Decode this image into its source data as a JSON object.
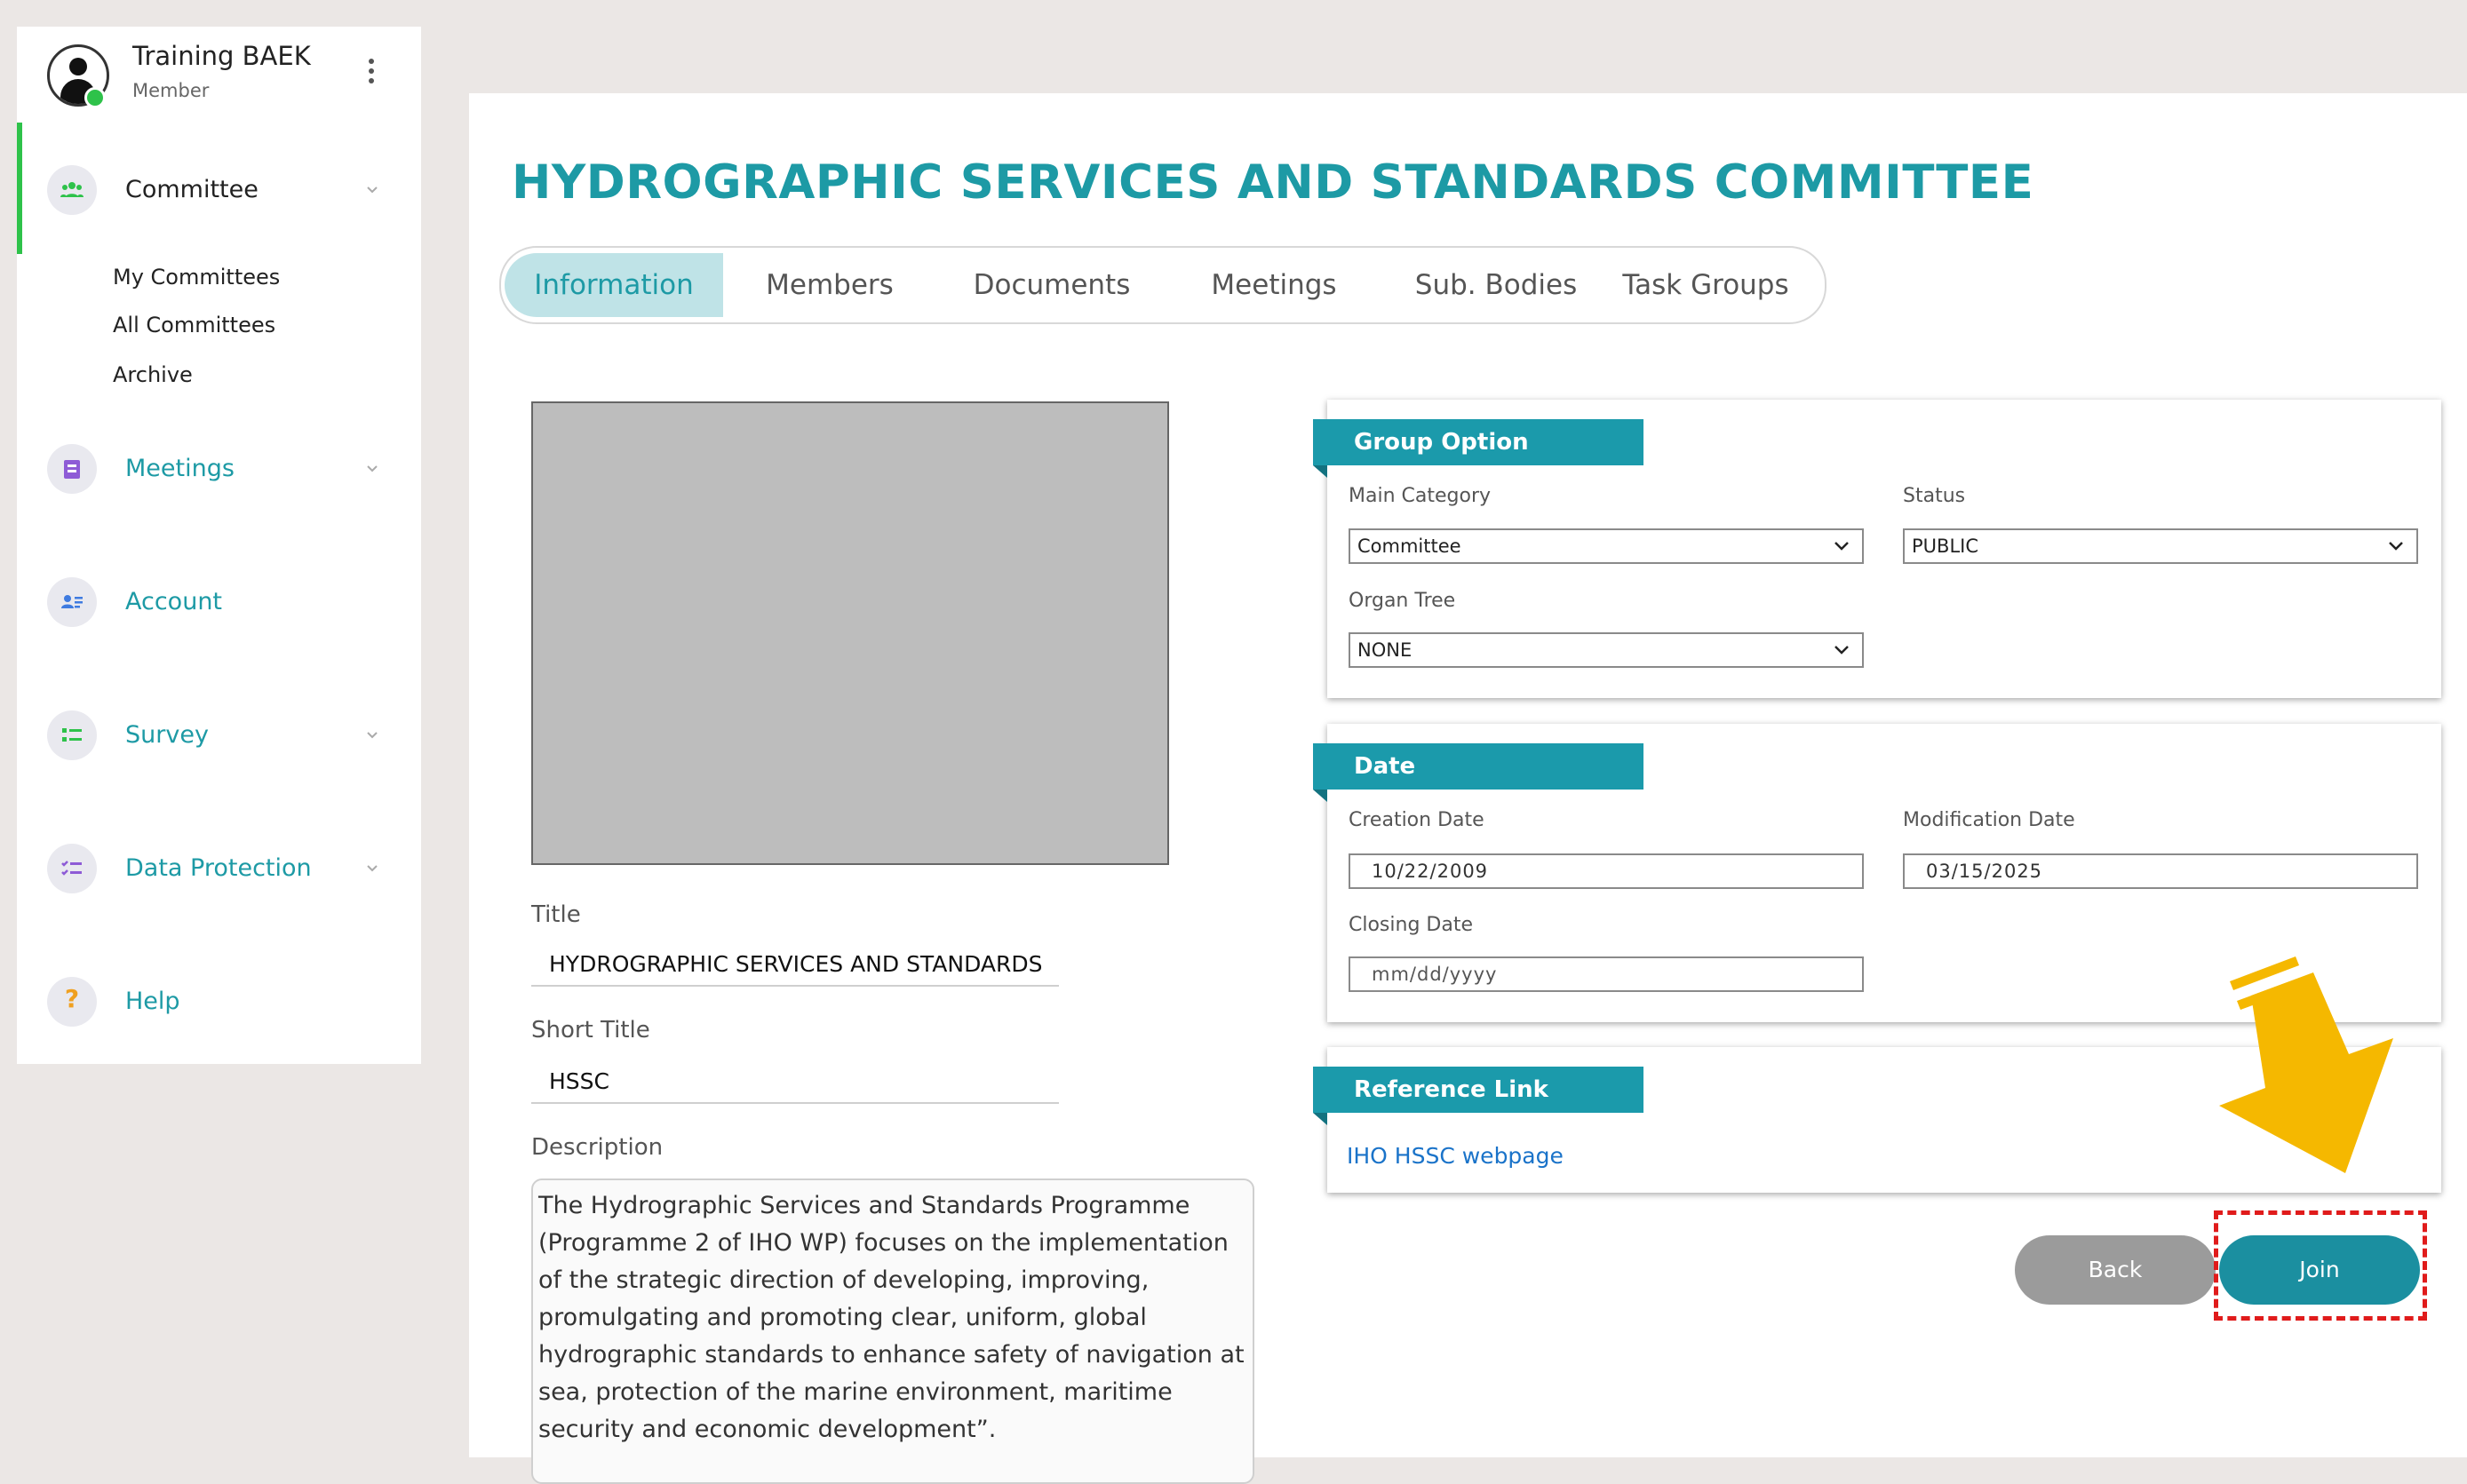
{
  "user": {
    "name": "Training BAEK",
    "role": "Member"
  },
  "sidebar": {
    "items": [
      {
        "label": "Committee",
        "icon": "users-icon",
        "color": "#222222"
      },
      {
        "label": "Meetings",
        "icon": "calendar-icon",
        "color": "#1d9aa5"
      },
      {
        "label": "Account",
        "icon": "id-card-icon",
        "color": "#1d9aa5"
      },
      {
        "label": "Survey",
        "icon": "list-icon",
        "color": "#1d9aa5"
      },
      {
        "label": "Data Protection",
        "icon": "checklist-icon",
        "color": "#1d9aa5"
      },
      {
        "label": "Help",
        "icon": "question-icon",
        "color": "#1d9aa5"
      }
    ],
    "committee_sub": [
      "My Committees",
      "All Committees",
      "Archive"
    ]
  },
  "page": {
    "title": "HYDROGRAPHIC SERVICES AND STANDARDS COMMITTEE"
  },
  "tabs": [
    "Information",
    "Members",
    "Documents",
    "Meetings",
    "Sub. Bodies",
    "Task Groups"
  ],
  "info": {
    "title_label": "Title",
    "title_value": "HYDROGRAPHIC SERVICES AND STANDARDS COMMITTEE",
    "short_title_label": "Short Title",
    "short_title_value": "HSSC",
    "description_label": "Description",
    "description_value": "The Hydrographic Services and Standards Programme (Programme 2 of IHO WP) focuses on the implementation of the strategic direction of developing, improving, promulgating and promoting clear, uniform, global hydrographic standards to enhance safety of navigation at sea, protection of the marine environment, maritime security and economic development”."
  },
  "group_option": {
    "header": "Group Option",
    "main_category_label": "Main Category",
    "main_category_value": "Committee",
    "status_label": "Status",
    "status_value": "PUBLIC",
    "organ_tree_label": "Organ Tree",
    "organ_tree_value": "NONE"
  },
  "date": {
    "header": "Date",
    "creation_label": "Creation Date",
    "creation_value": "10/22/2009",
    "modification_label": "Modification Date",
    "modification_value": "03/15/2025",
    "closing_label": "Closing Date",
    "closing_placeholder": "mm/dd/yyyy"
  },
  "reference": {
    "header": "Reference Link",
    "link_text": "IHO HSSC webpage"
  },
  "buttons": {
    "back": "Back",
    "join": "Join"
  },
  "colors": {
    "accent": "#1d9aa5",
    "card_header": "#1b9aab",
    "online": "#2ec24a",
    "highlight": "#e01b1b",
    "arrow": "#f5b800"
  }
}
